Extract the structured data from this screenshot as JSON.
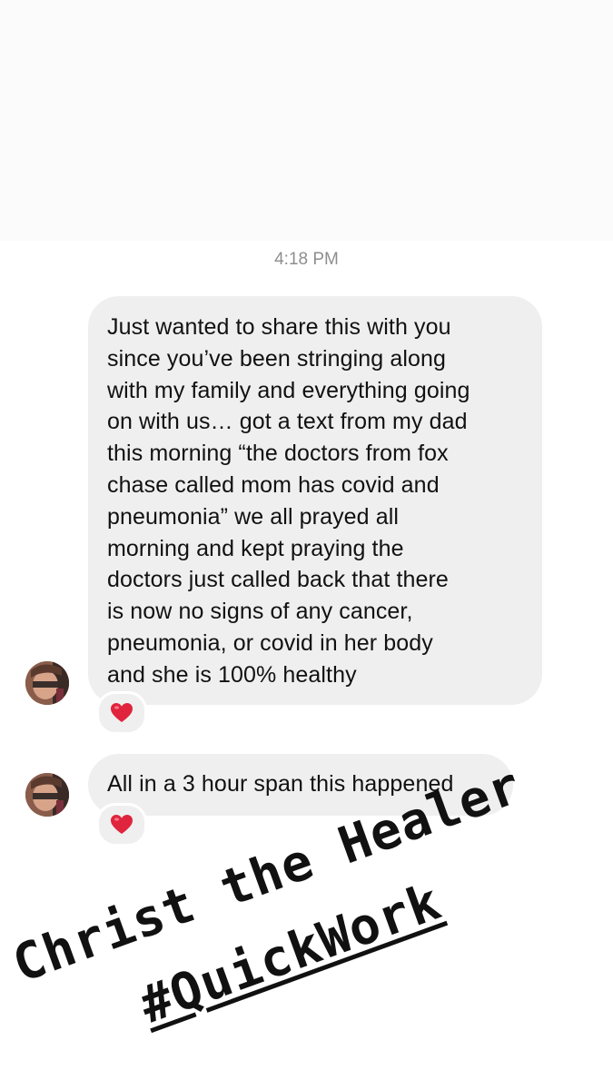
{
  "timestamp": "4:18 PM",
  "messages": [
    {
      "lines": [
        "Just wanted to share this with you",
        "since you’ve been stringing along",
        "with my family and everything going",
        "on with us… got a text from my dad",
        "this morning “the doctors from fox",
        "chase called mom has covid and",
        "pneumonia” we all prayed all",
        "morning and kept praying the",
        "doctors just called back that there",
        "is now no signs of any cancer,",
        "pneumonia, or covid in her body",
        "and she is 100% healthy"
      ],
      "reaction": "❤️",
      "reaction_icon": "heart-icon"
    },
    {
      "text": "All in a 3 hour span this happened",
      "reaction": "❤️",
      "reaction_icon": "heart-icon"
    }
  ],
  "overlay": {
    "line1": "Christ the Healer",
    "line2": "#QuickWork"
  },
  "colors": {
    "bubble": "#efefef",
    "timestamp": "#8e8e8e",
    "text": "#111111",
    "top_area": "#fbfbfb"
  }
}
